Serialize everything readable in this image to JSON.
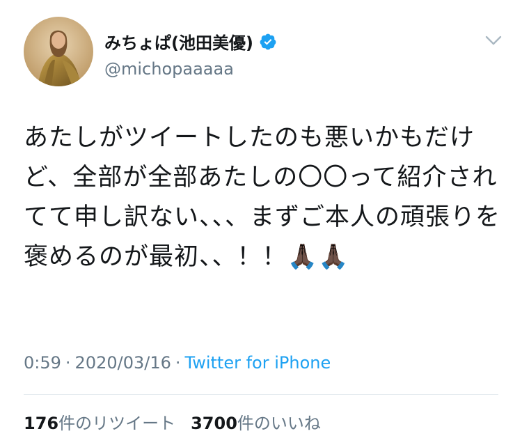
{
  "user": {
    "display_name": "みちょぱ(池田美優)",
    "handle": "@michopaaaaa",
    "verified_icon": "verified-badge-icon",
    "verified_color": "#1da1f2"
  },
  "tweet": {
    "text": "あたしがツイートしたのも悪いかもだけど、全部が全部あたしの〇〇って紹介されてて申し訳ない、、、まずご本人の頑張りを褒めるのが最初、、！！🙏🏿🙏🏿",
    "time": "0:59",
    "separator": "·",
    "date": "2020/03/16",
    "source": "Twitter for iPhone"
  },
  "stats": {
    "retweets_count": "176",
    "retweets_label": "件のリツイート",
    "likes_count": "3700",
    "likes_label": "件のいいね"
  },
  "colors": {
    "link": "#1da1f2",
    "secondary_text": "#657786",
    "primary_text": "#14171a"
  }
}
